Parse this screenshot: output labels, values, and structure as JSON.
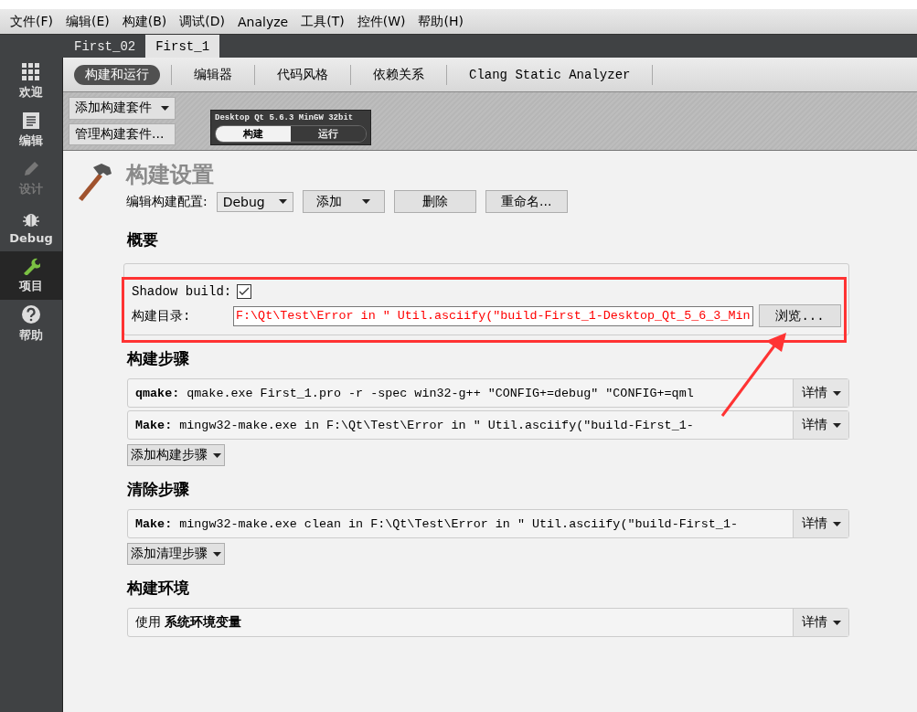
{
  "menu": [
    "文件(F)",
    "编辑(E)",
    "构建(B)",
    "调试(D)",
    "Analyze",
    "工具(T)",
    "控件(W)",
    "帮助(H)"
  ],
  "project_tabs": [
    {
      "label": "First_02",
      "selected": false
    },
    {
      "label": "First_1",
      "selected": true
    }
  ],
  "sidebar": [
    {
      "label": "欢迎",
      "kind": "grid",
      "selected": false,
      "disabled": false
    },
    {
      "label": "编辑",
      "kind": "document",
      "selected": false,
      "disabled": false
    },
    {
      "label": "设计",
      "kind": "pencil",
      "selected": false,
      "disabled": true
    },
    {
      "label": "Debug",
      "kind": "bug",
      "selected": false,
      "disabled": false
    },
    {
      "label": "项目",
      "kind": "wrench",
      "selected": true,
      "disabled": false
    },
    {
      "label": "帮助",
      "kind": "help",
      "selected": false,
      "disabled": false
    }
  ],
  "settings_tabs": [
    {
      "label": "构建和运行",
      "selected": true
    },
    {
      "label": "编辑器",
      "selected": false
    },
    {
      "label": "代码风格",
      "selected": false
    },
    {
      "label": "依赖关系",
      "selected": false
    },
    {
      "label": "Clang Static Analyzer",
      "selected": false
    }
  ],
  "kit_buttons": [
    {
      "label": "添加构建套件",
      "dropdown": true
    },
    {
      "label": "管理构建套件...",
      "dropdown": false
    }
  ],
  "kit": {
    "name": "Desktop Qt 5.6.3 MinGW 32bit",
    "modes": [
      {
        "label": "构建",
        "selected": true
      },
      {
        "label": "运行",
        "selected": false
      }
    ]
  },
  "build_settings": {
    "title": "构建设置",
    "config_label": "编辑构建配置:",
    "config_value": "Debug",
    "buttons": [
      {
        "label": "添加",
        "dropdown": true
      },
      {
        "label": "删除",
        "dropdown": false
      },
      {
        "label": "重命名...",
        "dropdown": false
      }
    ]
  },
  "overview": {
    "heading": "概要",
    "shadow_build_label": "Shadow build:",
    "shadow_build_checked": true,
    "dir_label": "构建目录:",
    "dir_value": "F:\\Qt\\Test\\Error in ″ Util.asciify(″build-First_1-Desktop_Qt_5_6_3_Min",
    "browse": "浏览..."
  },
  "sections": [
    {
      "heading": "构建步骤",
      "steps": [
        {
          "name": "qmake:",
          "command": "qmake.exe First_1.pro -r -spec win32-g++ ″CONFIG+=debug″ ″CONFIG+=qml",
          "details": "详情"
        },
        {
          "name": "Make:",
          "command": "mingw32-make.exe in F:\\Qt\\Test\\Error in ″ Util.asciify(″build-First_1-",
          "details": "详情"
        }
      ],
      "add": "添加构建步骤"
    },
    {
      "heading": "清除步骤",
      "steps": [
        {
          "name": "Make:",
          "command": "mingw32-make.exe clean in F:\\Qt\\Test\\Error in ″ Util.asciify(″build-First_1-",
          "details": "详情"
        }
      ],
      "add": "添加清理步骤"
    },
    {
      "heading": "构建环境",
      "steps": [
        {
          "text": "使用 **系统环境变量**",
          "details": "详情"
        }
      ]
    }
  ]
}
